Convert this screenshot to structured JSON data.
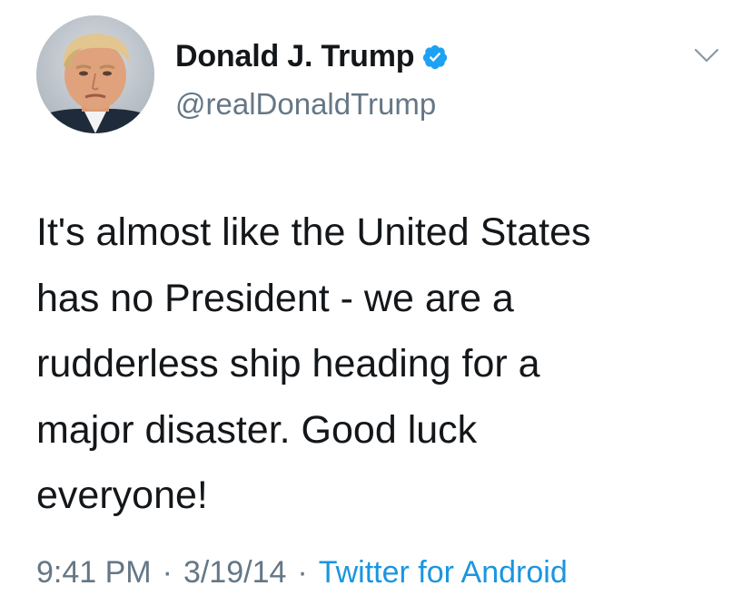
{
  "author": {
    "display_name": "Donald J. Trump",
    "handle": "@realDonaldTrump",
    "verified": true,
    "avatar_icon": "profile-photo"
  },
  "tweet": {
    "text": "It's almost like the United States\nhas no President - we are a\nrudderless ship heading for a\nmajor disaster. Good luck\neveryone!",
    "time": "9:41 PM",
    "date": "3/19/14",
    "source": "Twitter for Android",
    "separator": "·"
  },
  "colors": {
    "text_primary": "#14171a",
    "text_secondary": "#657786",
    "link": "#1b95e0",
    "verified_badge": "#1da1f2"
  },
  "icons": {
    "verified": "verified-badge-icon",
    "menu": "chevron-down-icon"
  }
}
